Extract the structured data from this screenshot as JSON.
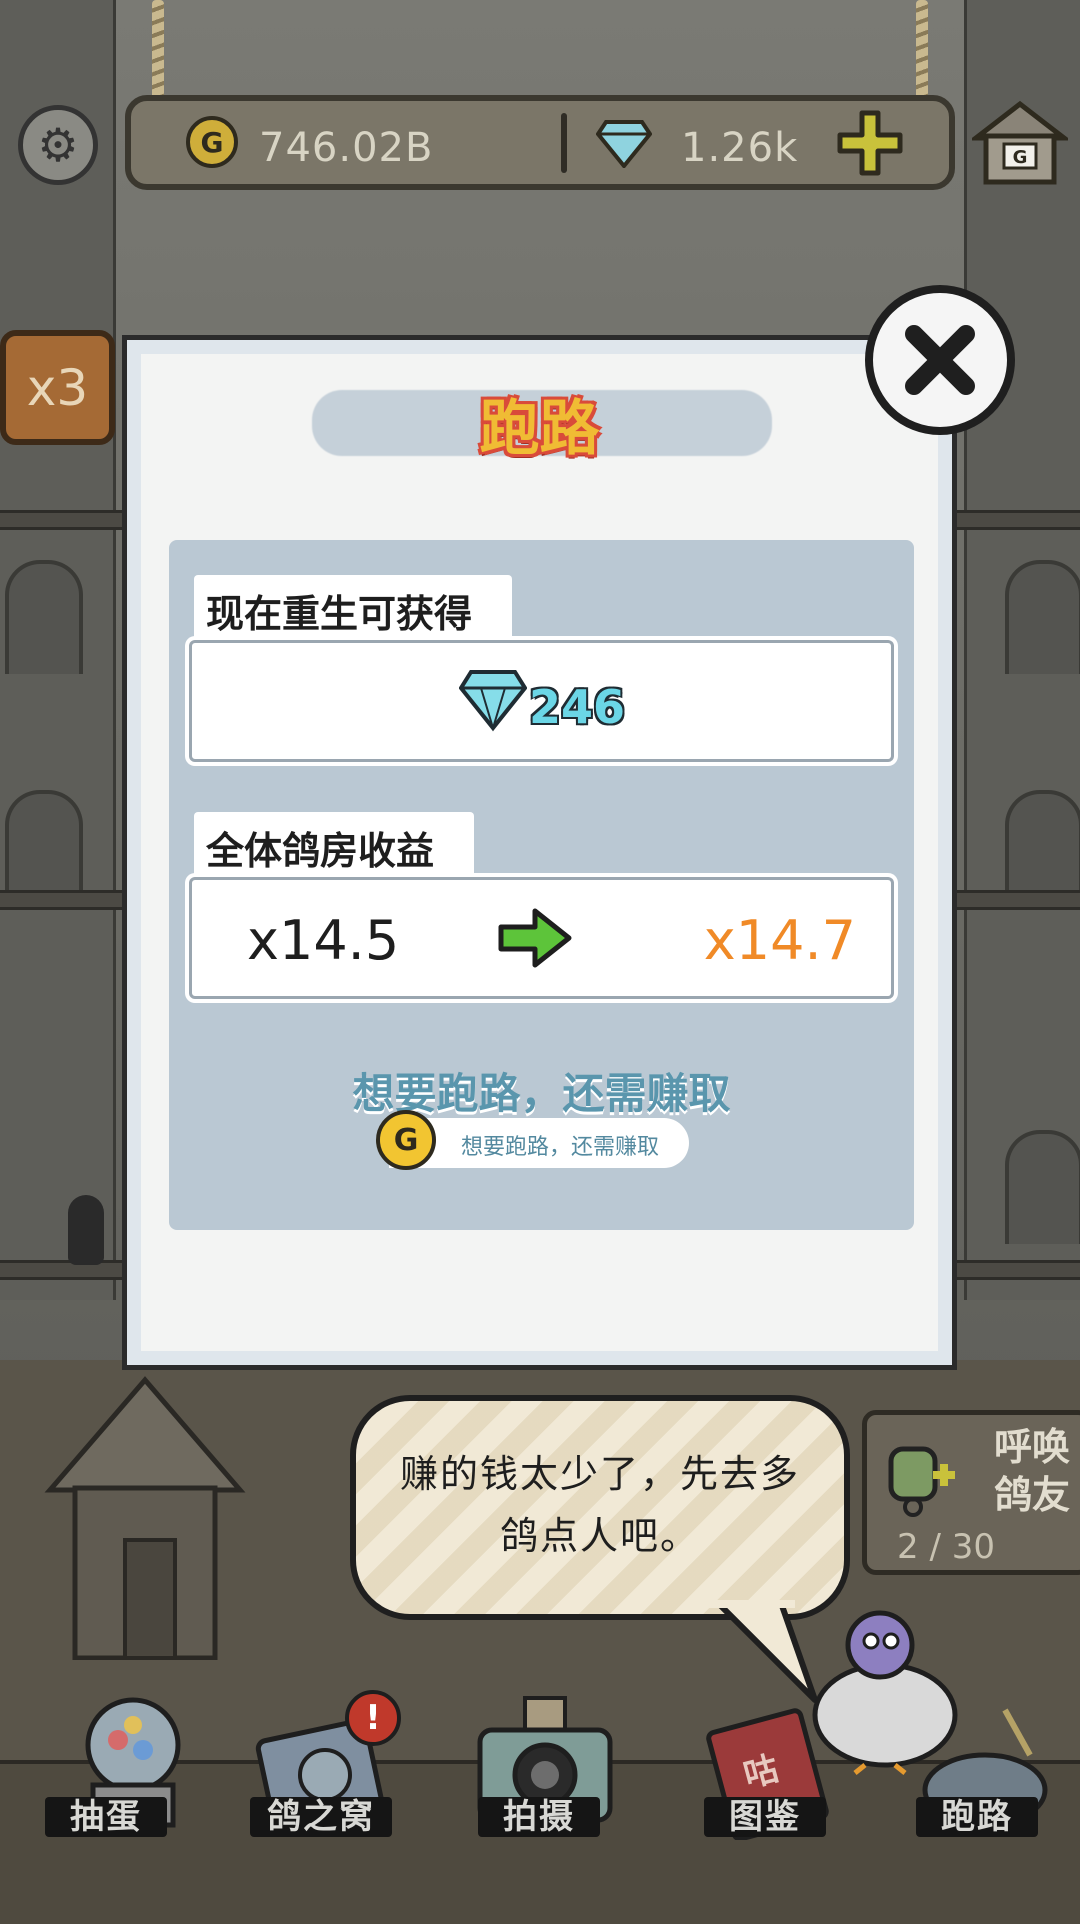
{
  "currency": {
    "coins": "746.02B",
    "coin_symbol": "G",
    "gems": "1.26k"
  },
  "home_icon_letter": "G",
  "multiplier_badge": "x3",
  "dialog": {
    "title": "跑路",
    "reward_section_label": "现在重生可获得",
    "reward_gems": "246",
    "income_section_label": "全体鸽房收益",
    "current_multiplier": "x14.5",
    "next_multiplier": "x14.7",
    "need_text": "想要跑路，还需赚取",
    "need_pill_text": "想要跑路，还需赚取",
    "need_coin_symbol": "G"
  },
  "speech_bubble": {
    "text_line1": "赚的钱太少了，先去多",
    "text_line2": "鸽点人吧。"
  },
  "summon": {
    "label": "呼唤鸽友",
    "count": "2 / 30"
  },
  "nav": {
    "items": [
      {
        "label": "抽蛋"
      },
      {
        "label": "鸽之窝"
      },
      {
        "label": "拍摄"
      },
      {
        "label": "图鉴"
      },
      {
        "label": "跑路"
      }
    ],
    "badge": "!",
    "book_char": "咕"
  },
  "colors": {
    "accent_orange": "#f08a27",
    "gem_cyan": "#6bd6e6",
    "title_yellow": "#f0bc34",
    "title_red": "#d94b3a",
    "arrow_green": "#5dc43a",
    "hint_blue": "#5a96ad"
  },
  "icons": {
    "settings": "gear-icon",
    "home": "pigeon-house-icon",
    "add": "plus-icon",
    "close": "close-icon",
    "gem": "diamond-icon",
    "coin": "coin-icon",
    "arrow": "arrow-right-icon"
  }
}
